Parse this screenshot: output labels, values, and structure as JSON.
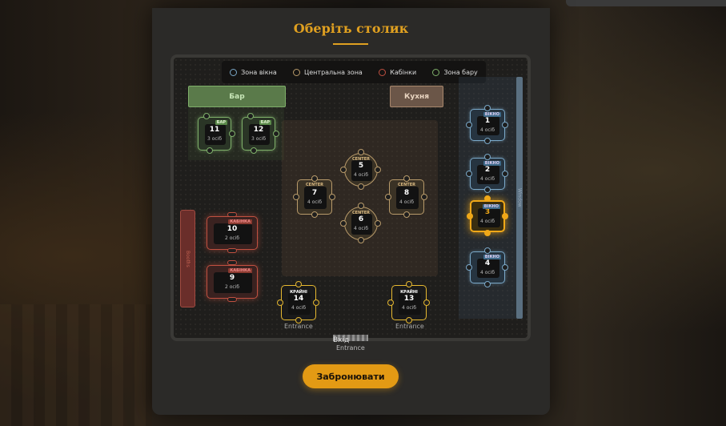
{
  "title": "Оберіть столик",
  "legend": [
    {
      "label": "Зона вікна",
      "color": "#7aa8c8"
    },
    {
      "label": "Центральна зона",
      "color": "#b89a6a"
    },
    {
      "label": "Кабінки",
      "color": "#c05040"
    },
    {
      "label": "Зона бару",
      "color": "#7fb06a"
    }
  ],
  "zones": {
    "bar": "Бар",
    "kitchen": "Кухня",
    "window_strip": "Window",
    "booth_strip": "Booths"
  },
  "tables": {
    "t1": {
      "num": "1",
      "tag": "ВІКНО",
      "cap": "4 осіб"
    },
    "t2": {
      "num": "2",
      "tag": "ВІКНО",
      "cap": "4 осіб"
    },
    "t3": {
      "num": "3",
      "tag": "ВІКНО",
      "cap": "4 осіб"
    },
    "t4": {
      "num": "4",
      "tag": "ВІКНО",
      "cap": "4 осіб"
    },
    "t5": {
      "num": "5",
      "tag": "CENTER",
      "cap": "4 осіб"
    },
    "t6": {
      "num": "6",
      "tag": "CENTER",
      "cap": "4 осіб"
    },
    "t7": {
      "num": "7",
      "tag": "CENTER",
      "cap": "4 осіб"
    },
    "t8": {
      "num": "8",
      "tag": "CENTER",
      "cap": "4 осіб"
    },
    "t9": {
      "num": "9",
      "tag": "КАБІНКА",
      "cap": "2 осіб"
    },
    "t10": {
      "num": "10",
      "tag": "КАБІНКА",
      "cap": "2 осіб"
    },
    "t11": {
      "num": "11",
      "tag": "БАР",
      "cap": "3 осіб"
    },
    "t12": {
      "num": "12",
      "tag": "БАР",
      "cap": "3 осіб"
    },
    "t13": {
      "num": "13",
      "tag": "КРАЙНІ",
      "cap": "4 осіб"
    },
    "t14": {
      "num": "14",
      "tag": "КРАЙНІ",
      "cap": "4 осіб"
    }
  },
  "entrance_label": "Entrance",
  "entry": {
    "label": "Вхід",
    "sub": "Entrance"
  },
  "book_button": "Забронювати"
}
